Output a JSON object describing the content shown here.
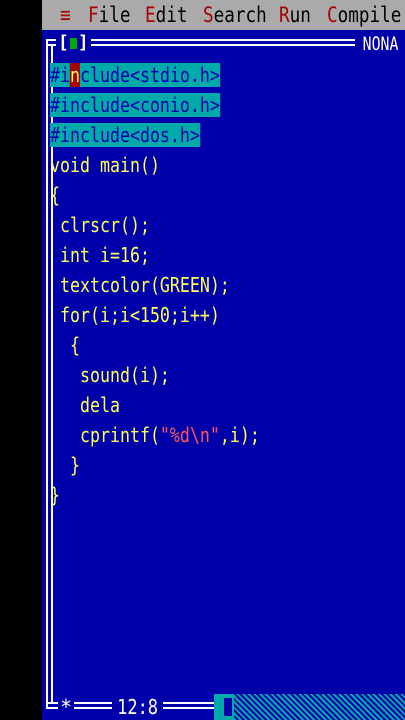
{
  "menu": {
    "system": "≡",
    "items": [
      {
        "hot": "F",
        "rest": "ile"
      },
      {
        "hot": "E",
        "rest": "dit"
      },
      {
        "hot": "S",
        "rest": "earch"
      },
      {
        "hot": "R",
        "rest": "un"
      },
      {
        "hot": "C",
        "rest": "ompile"
      }
    ]
  },
  "window": {
    "title": "NONA",
    "close_left": "[",
    "close_right": "]"
  },
  "code": {
    "line1": {
      "a": "#i",
      "cursor": "n",
      "b": "clude<stdio.h>"
    },
    "line2": "#include<conio.h>",
    "line3": "#include<dos.h>",
    "line4": "void main()",
    "line5": "{",
    "line6": " clrscr();",
    "line7": " int i=16;",
    "line8": " textcolor(GREEN);",
    "line9": " for(i;i<150;i++)",
    "line10": "  {",
    "line11": "   sound(i);",
    "line12": "   dela",
    "line13": {
      "pre": "   cprintf(",
      "str": "\"%d\\n\"",
      "post": ",i);"
    },
    "line14": "  }",
    "line15": "}"
  },
  "status": {
    "position": "12:8",
    "modified": "*"
  },
  "colors": {
    "background": "#0000AA",
    "text": "#FFFF55",
    "selection": "#00AAAA",
    "menu_bar": "#AAAAAA",
    "hotkey": "#AA0000",
    "string": "#FF5555"
  }
}
